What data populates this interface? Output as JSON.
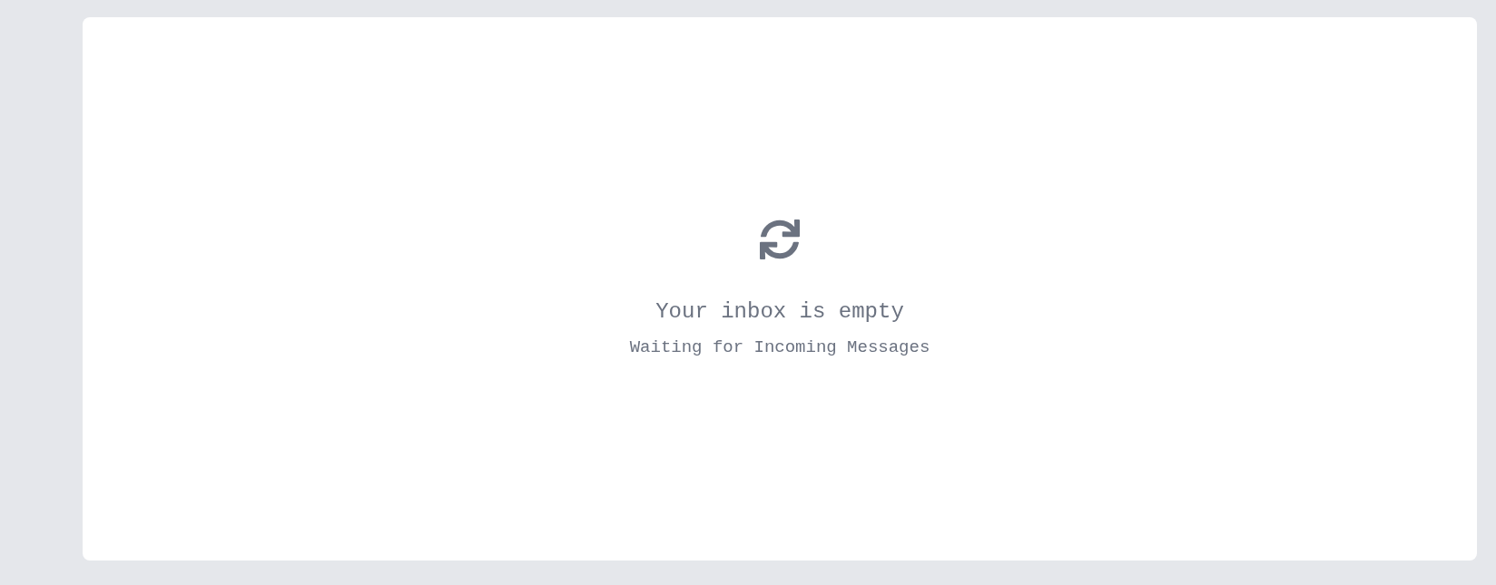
{
  "empty_state": {
    "title": "Your inbox is empty",
    "subtitle": "Waiting for Incoming Messages"
  }
}
